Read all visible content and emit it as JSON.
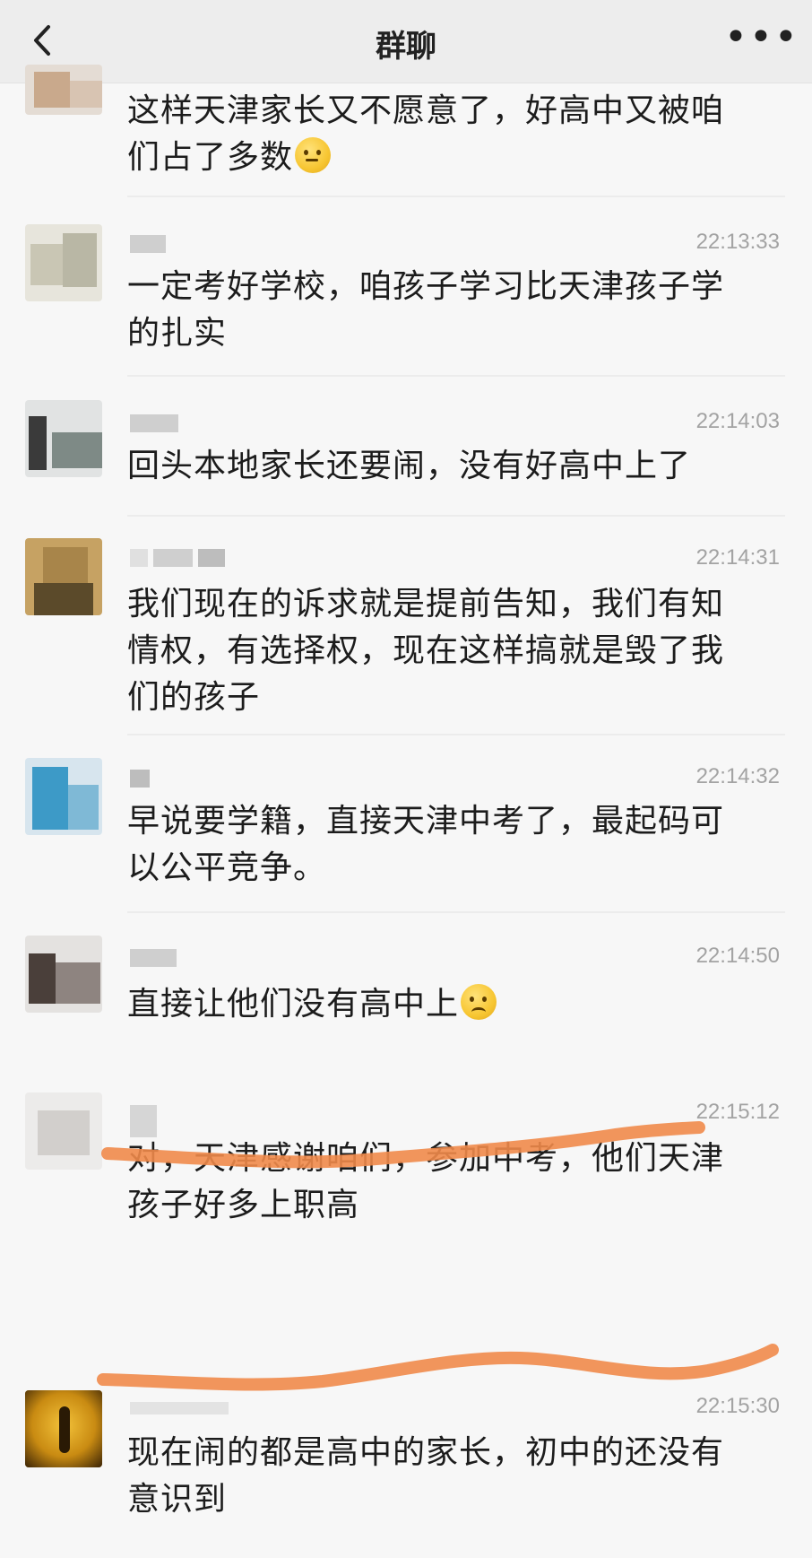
{
  "header": {
    "title": "群聊",
    "more": "•••"
  },
  "messages": [
    {
      "time": "",
      "text_lines": [
        "这样天津家长又不愿意了，好高中又被咱",
        "们占了多数"
      ],
      "emoji": "thinking-face"
    },
    {
      "time": "22:13:33",
      "text_lines": [
        "一定考好学校，咱孩子学习比天津孩子学",
        "的扎实"
      ]
    },
    {
      "time": "22:14:03",
      "text_lines": [
        "回头本地家长还要闹，没有好高中上了"
      ]
    },
    {
      "time": "22:14:31",
      "text_lines": [
        "我们现在的诉求就是提前告知，我们有知",
        "情权，有选择权，现在这样搞就是毁了我",
        "们的孩子"
      ]
    },
    {
      "time": "22:14:32",
      "text_lines": [
        "早说要学籍，直接天津中考了，最起码可",
        "以公平竞争。"
      ]
    },
    {
      "time": "22:14:50",
      "text_lines": [
        "直接让他们没有高中上"
      ],
      "emoji": "frowning-face"
    },
    {
      "time": "22:15:12",
      "text_lines": [
        "对，天津感谢咱们，参加中考，他们天津",
        "孩子好多上职高"
      ]
    },
    {
      "time": "22:15:30",
      "text_lines": [
        "现在闹的都是高中的家长，初中的还没有",
        "意识到"
      ]
    }
  ],
  "icons": {
    "back": "chevron-left-icon",
    "more": "more-dots-icon"
  },
  "colors": {
    "background": "#f7f7f7",
    "topbar": "#ededed",
    "timestamp": "#a3a3a3",
    "highlight_scribble": "#f0894a"
  }
}
